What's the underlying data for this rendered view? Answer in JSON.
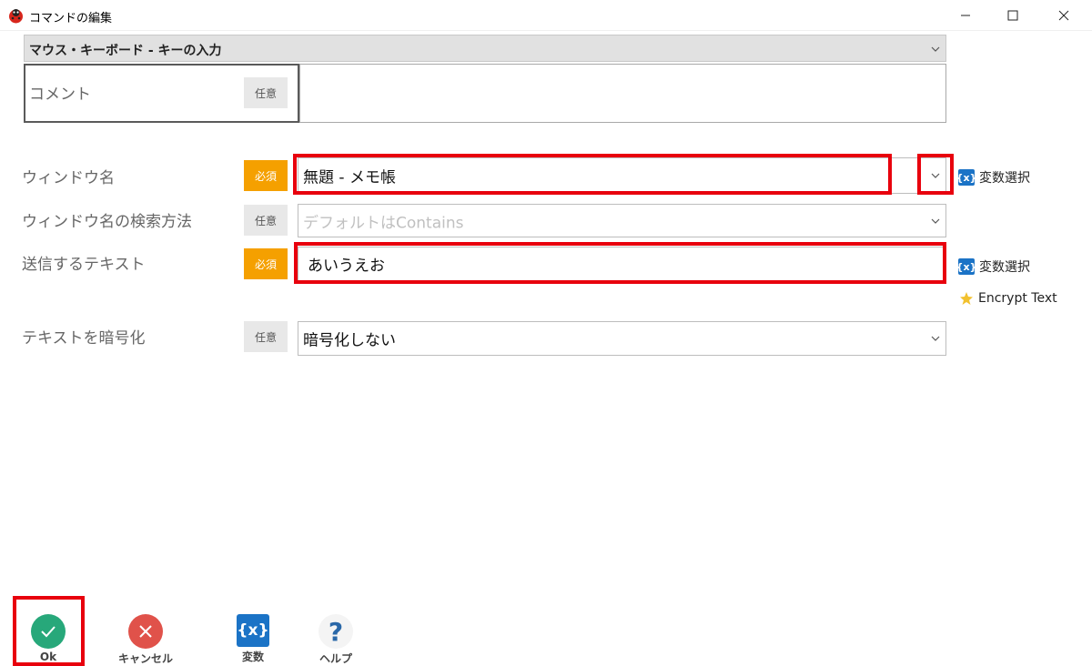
{
  "window": {
    "title": "コマンドの編集"
  },
  "command_select": {
    "value": "マウス・キーボード - キーの入力"
  },
  "comment": {
    "label": "コメント",
    "badge": "任意",
    "value": ""
  },
  "fields": {
    "window_name": {
      "label": "ウィンドウ名",
      "badge": "必須",
      "value": "無題 - メモ帳",
      "var_link": "変数選択"
    },
    "search_method": {
      "label": "ウィンドウ名の検索方法",
      "badge": "任意",
      "placeholder": "デフォルトはContains"
    },
    "send_text": {
      "label": "送信するテキスト",
      "badge": "必須",
      "value": "あいうえお",
      "var_link": "変数選択",
      "encrypt_link": "Encrypt Text"
    },
    "encrypt": {
      "label": "テキストを暗号化",
      "badge": "任意",
      "value": "暗号化しない"
    }
  },
  "toolbar": {
    "ok": "Ok",
    "cancel": "キャンセル",
    "variables": "変数",
    "help": "ヘルプ"
  },
  "colors": {
    "required": "#f5a000",
    "optional": "#e8e8e8",
    "highlight": "#e8000d",
    "ok": "#27a87a",
    "cancel": "#e0524a",
    "variable": "#1b73c6"
  },
  "icons": {
    "app": "app-ladybug-icon",
    "variable": "variable-icon",
    "encrypt": "star-icon",
    "help": "question-icon"
  }
}
